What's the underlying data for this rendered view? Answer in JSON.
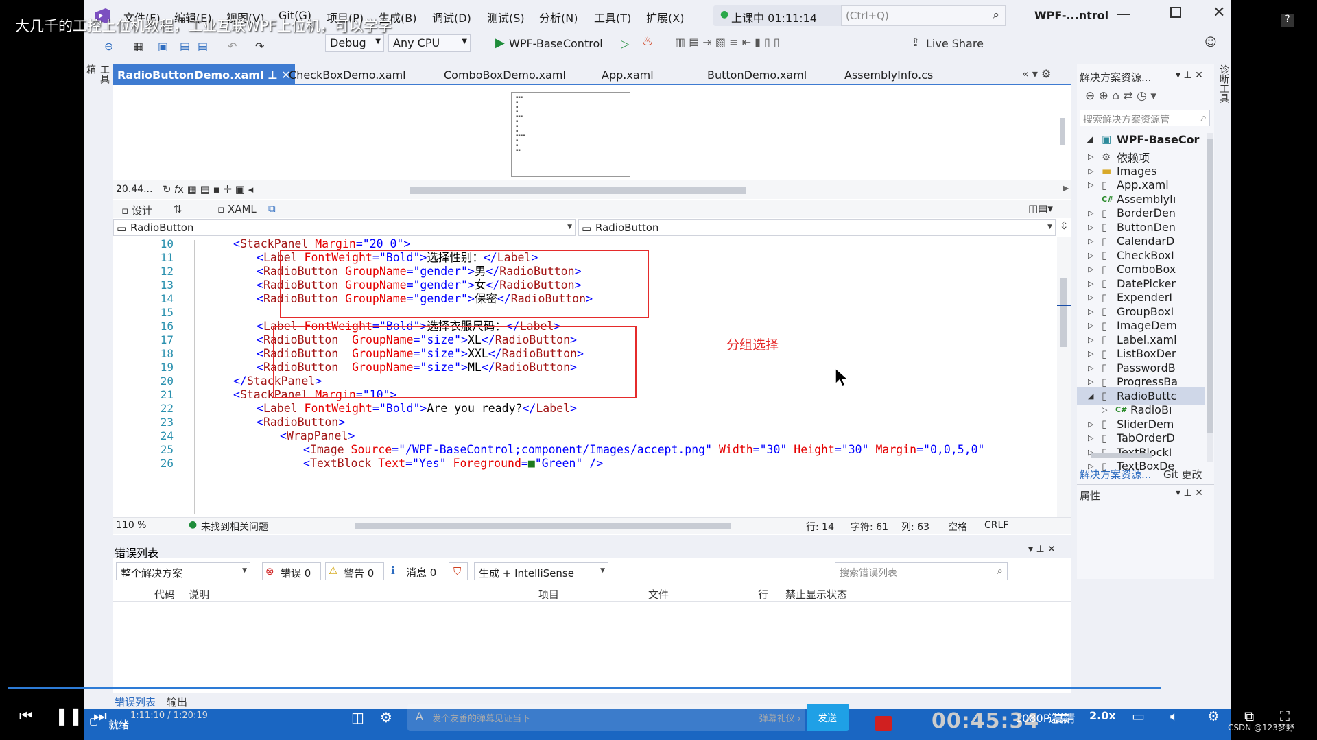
{
  "overlay_title": "大几千的工控上位机教程，工业互联WPF上位机，可以学学",
  "titlebar": {
    "menus": [
      "文件(F)",
      "编辑(E)",
      "视图(V)",
      "Git(G)",
      "项目(P)",
      "生成(B)",
      "调试(D)",
      "测试(S)",
      "分析(N)",
      "工具(T)",
      "扩展(X)"
    ],
    "live_status": "上课中 01:11:14",
    "search_placeholder": "(Ctrl+Q)",
    "window_title": "WPF-...ntrol"
  },
  "toolbar": {
    "config": "Debug",
    "platform": "Any CPU",
    "run_target": "WPF-BaseControl",
    "live_share": "Live Share"
  },
  "tabs": [
    {
      "label": "RadioButtonDemo.xaml",
      "active": true
    },
    {
      "label": "CheckBoxDemo.xaml"
    },
    {
      "label": "ComboBoxDemo.xaml"
    },
    {
      "label": "App.xaml"
    },
    {
      "label": "ButtonDemo.xaml"
    },
    {
      "label": "AssemblyInfo.cs"
    }
  ],
  "side_vertical_left": "工具箱",
  "side_vertical_right": "诊断工具",
  "designer": {
    "zoom": "20.44...",
    "design_tab": "设计",
    "xaml_tab": "XAML",
    "left_selector": "RadioButton",
    "right_selector": "RadioButton"
  },
  "code": [
    {
      "n": "10",
      "parts": [
        [
          "b",
          "<"
        ],
        [
          "d",
          "StackPanel"
        ],
        [
          "r",
          " Margin"
        ],
        [
          "b",
          "=\"20 0\">"
        ]
      ],
      "indent": 0
    },
    {
      "n": "11",
      "parts": [
        [
          "b",
          "<"
        ],
        [
          "d",
          "Label"
        ],
        [
          "r",
          " FontWeight"
        ],
        [
          "b",
          "=\"Bold\">"
        ],
        [
          "t",
          "选择性别："
        ],
        [
          "b",
          "</"
        ],
        [
          "d",
          "Label"
        ],
        [
          "b",
          ">"
        ]
      ],
      "indent": 1
    },
    {
      "n": "12",
      "parts": [
        [
          "b",
          "<"
        ],
        [
          "d",
          "RadioButton"
        ],
        [
          "r",
          " GroupName"
        ],
        [
          "b",
          "=\"gender\">"
        ],
        [
          "t",
          "男"
        ],
        [
          "b",
          "</"
        ],
        [
          "d",
          "RadioButton"
        ],
        [
          "b",
          ">"
        ]
      ],
      "indent": 1
    },
    {
      "n": "13",
      "parts": [
        [
          "b",
          "<"
        ],
        [
          "d",
          "RadioButton"
        ],
        [
          "r",
          " GroupName"
        ],
        [
          "b",
          "=\"gender\">"
        ],
        [
          "t",
          "女"
        ],
        [
          "b",
          "</"
        ],
        [
          "d",
          "RadioButton"
        ],
        [
          "b",
          ">"
        ]
      ],
      "indent": 1
    },
    {
      "n": "14",
      "parts": [
        [
          "b",
          "<"
        ],
        [
          "d",
          "RadioButton"
        ],
        [
          "r",
          " GroupName"
        ],
        [
          "b",
          "=\"gender\">"
        ],
        [
          "t",
          "保密"
        ],
        [
          "b",
          "</"
        ],
        [
          "d",
          "RadioButton"
        ],
        [
          "b",
          ">"
        ]
      ],
      "indent": 1
    },
    {
      "n": "15",
      "parts": [],
      "indent": 1
    },
    {
      "n": "16",
      "parts": [
        [
          "b",
          "<"
        ],
        [
          "d",
          "Label"
        ],
        [
          "r",
          " FontWeight"
        ],
        [
          "b",
          "=\"Bold\">"
        ],
        [
          "t",
          "选择衣服尺码："
        ],
        [
          "b",
          "</"
        ],
        [
          "d",
          "Label"
        ],
        [
          "b",
          ">"
        ]
      ],
      "indent": 1
    },
    {
      "n": "17",
      "parts": [
        [
          "b",
          "<"
        ],
        [
          "d",
          "RadioButton"
        ],
        [
          "r",
          "  GroupName"
        ],
        [
          "b",
          "=\"size\">"
        ],
        [
          "t",
          "XL"
        ],
        [
          "b",
          "</"
        ],
        [
          "d",
          "RadioButton"
        ],
        [
          "b",
          ">"
        ]
      ],
      "indent": 1
    },
    {
      "n": "18",
      "parts": [
        [
          "b",
          "<"
        ],
        [
          "d",
          "RadioButton"
        ],
        [
          "r",
          "  GroupName"
        ],
        [
          "b",
          "=\"size\">"
        ],
        [
          "t",
          "XXL"
        ],
        [
          "b",
          "</"
        ],
        [
          "d",
          "RadioButton"
        ],
        [
          "b",
          ">"
        ]
      ],
      "indent": 1
    },
    {
      "n": "19",
      "parts": [
        [
          "b",
          "<"
        ],
        [
          "d",
          "RadioButton"
        ],
        [
          "r",
          "  GroupName"
        ],
        [
          "b",
          "=\"size\">"
        ],
        [
          "t",
          "ML"
        ],
        [
          "b",
          "</"
        ],
        [
          "d",
          "RadioButton"
        ],
        [
          "b",
          ">"
        ]
      ],
      "indent": 1
    },
    {
      "n": "20",
      "parts": [
        [
          "b",
          "</"
        ],
        [
          "d",
          "StackPanel"
        ],
        [
          "b",
          ">"
        ]
      ],
      "indent": 0
    },
    {
      "n": "21",
      "parts": [
        [
          "b",
          "<"
        ],
        [
          "d",
          "StackPanel"
        ],
        [
          "r",
          " Margin"
        ],
        [
          "b",
          "=\"10\">"
        ]
      ],
      "indent": 0
    },
    {
      "n": "22",
      "parts": [
        [
          "b",
          "<"
        ],
        [
          "d",
          "Label"
        ],
        [
          "r",
          " FontWeight"
        ],
        [
          "b",
          "=\"Bold\">"
        ],
        [
          "t",
          "Are you ready?"
        ],
        [
          "b",
          "</"
        ],
        [
          "d",
          "Label"
        ],
        [
          "b",
          ">"
        ]
      ],
      "indent": 1
    },
    {
      "n": "23",
      "parts": [
        [
          "b",
          "<"
        ],
        [
          "d",
          "RadioButton"
        ],
        [
          "b",
          ">"
        ]
      ],
      "indent": 1
    },
    {
      "n": "24",
      "parts": [
        [
          "b",
          "<"
        ],
        [
          "d",
          "WrapPanel"
        ],
        [
          "b",
          ">"
        ]
      ],
      "indent": 2
    },
    {
      "n": "25",
      "parts": [
        [
          "b",
          "<"
        ],
        [
          "d",
          "Image"
        ],
        [
          "r",
          " Source"
        ],
        [
          "b",
          "=\"/WPF-BaseControl;component/Images/accept.png\""
        ],
        [
          "r",
          " Width"
        ],
        [
          "b",
          "=\"30\""
        ],
        [
          "r",
          " Height"
        ],
        [
          "b",
          "=\"30\""
        ],
        [
          "r",
          " Margin"
        ],
        [
          "b",
          "=\"0,0,5,0\""
        ]
      ],
      "indent": 3
    },
    {
      "n": "26",
      "parts": [
        [
          "b",
          "<"
        ],
        [
          "d",
          "TextBlock"
        ],
        [
          "r",
          " Text"
        ],
        [
          "b",
          "=\"Yes\""
        ],
        [
          "r",
          " Foreground"
        ],
        [
          "b",
          "="
        ],
        [
          "g",
          "■"
        ],
        [
          "b",
          "\"Green\""
        ],
        [
          "b",
          " />"
        ]
      ],
      "indent": 3
    }
  ],
  "annotation": "分组选择",
  "status_line": {
    "zoom": "110 %",
    "issues": "未找到相关问题",
    "row": "行: 14",
    "char": "字符: 61",
    "col": "列: 63",
    "ws": "空格",
    "eol": "CRLF"
  },
  "error_list": {
    "title": "错误列表",
    "scope": "整个解决方案",
    "errors": "错误 0",
    "warnings": "警告 0",
    "messages": "消息 0",
    "build_filter": "生成 + IntelliSense",
    "search_placeholder": "搜索错误列表",
    "columns": [
      "代码",
      "说明",
      "项目",
      "文件",
      "行",
      "禁止显示状态"
    ]
  },
  "bottom_tabs": [
    "错误列表",
    "输出"
  ],
  "status_bar": "就绪",
  "solution": {
    "title": "解决方案资源...",
    "search_placeholder": "搜索解决方案资源管",
    "project": "WPF-BaseCor",
    "items": [
      {
        "label": "依赖项",
        "icon": "dependency-icon",
        "arrow": true
      },
      {
        "label": "Images",
        "icon": "folder-icon",
        "arrow": true
      },
      {
        "label": "App.xaml",
        "icon": "xaml-file-icon",
        "arrow": true
      },
      {
        "label": "AssemblyIı",
        "icon": "cs-file-icon",
        "arrow": false
      },
      {
        "label": "BorderDen",
        "icon": "xaml-file-icon",
        "arrow": true
      },
      {
        "label": "ButtonDen",
        "icon": "xaml-file-icon",
        "arrow": true
      },
      {
        "label": "CalendarD",
        "icon": "xaml-file-icon",
        "arrow": true
      },
      {
        "label": "CheckBoxI",
        "icon": "xaml-file-icon",
        "arrow": true
      },
      {
        "label": "ComboBox",
        "icon": "xaml-file-icon",
        "arrow": true
      },
      {
        "label": "DatePicker",
        "icon": "xaml-file-icon",
        "arrow": true
      },
      {
        "label": "ExpenderI",
        "icon": "xaml-file-icon",
        "arrow": true
      },
      {
        "label": "GroupBoxI",
        "icon": "xaml-file-icon",
        "arrow": true
      },
      {
        "label": "ImageDem",
        "icon": "xaml-file-icon",
        "arrow": true
      },
      {
        "label": "Label.xaml",
        "icon": "xaml-file-icon",
        "arrow": true
      },
      {
        "label": "ListBoxDer",
        "icon": "xaml-file-icon",
        "arrow": true
      },
      {
        "label": "PasswordB",
        "icon": "xaml-file-icon",
        "arrow": true
      },
      {
        "label": "ProgressBa",
        "icon": "xaml-file-icon",
        "arrow": true
      },
      {
        "label": "RadioButtc",
        "icon": "xaml-file-icon",
        "arrow": true,
        "selected": true
      },
      {
        "label": "RadioBı",
        "icon": "cs-file-icon",
        "arrow": true,
        "child": true
      },
      {
        "label": "SliderDem",
        "icon": "xaml-file-icon",
        "arrow": true
      },
      {
        "label": "TabOrderD",
        "icon": "xaml-file-icon",
        "arrow": true
      },
      {
        "label": "TextBlockI",
        "icon": "xaml-file-icon",
        "arrow": true
      },
      {
        "label": "TextBoxDe",
        "icon": "xaml-file-icon",
        "arrow": true
      }
    ],
    "footer_tab1": "解决方案资源...",
    "footer_tab2": "Git 更改",
    "properties": "属性"
  },
  "player": {
    "time_small": "1:11:10 / 1:20:19",
    "danmaku_placeholder": "发个友善的弹幕见证当下",
    "danmaku_etiquette": "弹幕礼仪 ›",
    "send": "发送",
    "clock": "00:45:34",
    "quality": "1080P 高清",
    "episodes": "选集",
    "speed": "2.0x",
    "watermark": "CSDN @123梦野"
  }
}
